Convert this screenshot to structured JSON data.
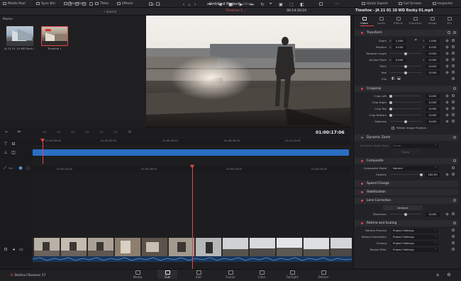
{
  "topbar": {
    "media_pool": "Media Pool",
    "sync_bin": "Sync Bin",
    "transitions": "Transitions",
    "titles": "Titles",
    "effects": "Effects",
    "project_title": "Untitled Project",
    "edited": "Edited",
    "quick_export": "Quick Export",
    "full_screen": "Full Screen",
    "inspector": "Inspector"
  },
  "toolbar": {
    "search_placeholder": "Search",
    "timeline_name": "Timeline 1",
    "timecode_top": "00:14:30:24"
  },
  "pool": {
    "master": "Master",
    "clips": [
      {
        "label": "JA 21 01 10 WD Rock..."
      },
      {
        "label": "Timeline 1"
      }
    ]
  },
  "viewer": {
    "timecode": "01:00:17:06"
  },
  "timeline": {
    "upper_ruler": [
      "01:00:00:00",
      "01:02:52:20",
      "01:05:45:15",
      "01:08:38:10",
      "01:11:31:05"
    ],
    "lower_ruler": [
      "01:00:14:00",
      "01:00:16:00",
      "01:00:18:00",
      "01:00:20:00"
    ],
    "track_label": "3KL"
  },
  "inspector": {
    "title": "Timeline - JA 21 01 10 WD Rocky 01.mp4",
    "tabs": [
      "Video",
      "Audio",
      "Effects",
      "Transition",
      "Image",
      "File"
    ],
    "transform": {
      "header": "Transform",
      "zoom_x": "1.000",
      "zoom_y": "1.000",
      "pos_x": "0.000",
      "pos_y": "0.000",
      "rotation": "0.000",
      "anchor_x": "0.000",
      "anchor_y": "0.000",
      "pitch": "0.000",
      "yaw": "0.000",
      "labels": [
        "Zoom",
        "Position",
        "Rotation Angle",
        "Anchor Point",
        "Pitch",
        "Yaw",
        "Flip"
      ]
    },
    "cropping": {
      "header": "Cropping",
      "labels": [
        "Crop Left",
        "Crop Right",
        "Crop Top",
        "Crop Bottom",
        "Softness"
      ],
      "values": [
        "0.000",
        "0.000",
        "0.000",
        "0.000",
        "0.000"
      ],
      "retain": "Retain Image Position"
    },
    "dynamic_zoom": {
      "header": "Dynamic Zoom",
      "ease_label": "Dynamic Zoom Ease",
      "ease_value": "Linear",
      "swap": "Swap"
    },
    "composite": {
      "header": "Composite",
      "mode_label": "Composite Mode",
      "mode_value": "Normal",
      "opacity_label": "Opacity",
      "opacity_value": "100.00"
    },
    "speed_change": "Speed Change",
    "stabilization": "Stabilization",
    "lens_correction": {
      "header": "Lens Correction",
      "analyze": "Analyze",
      "distortion_label": "Distortion",
      "distortion_value": "0.000"
    },
    "retime": {
      "header": "Retime and Scaling",
      "labels": [
        "Retime Process",
        "Motion Estimation",
        "Scaling",
        "Resize Filter"
      ],
      "values": [
        "Project Settings",
        "Project Settings",
        "Project Settings",
        "Project Settings"
      ]
    }
  },
  "bottom": {
    "brand": "DaVinci Resolve 17",
    "tabs": [
      "Media",
      "Cut",
      "Edit",
      "Fusion",
      "Color",
      "Fairlight",
      "Deliver"
    ],
    "active": "Cut"
  },
  "colors": {
    "accent_red": "#e0464c",
    "track_blue": "#2a6fc4",
    "panel_bg": "#1e1e21"
  }
}
